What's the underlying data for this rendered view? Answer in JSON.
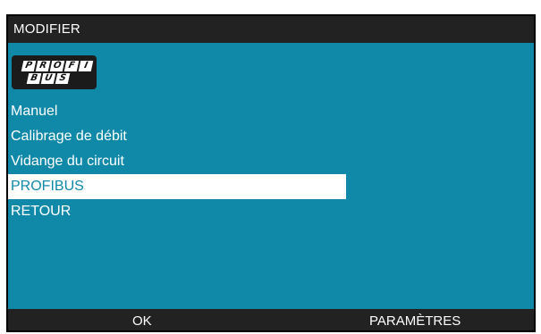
{
  "header": {
    "title": "MODIFIER"
  },
  "logo": {
    "icon": "profibus-logo-icon",
    "row1": [
      "P",
      "R",
      "O",
      "F",
      "I"
    ],
    "row2": [
      "B",
      "U",
      "S"
    ]
  },
  "menu": {
    "items": [
      {
        "label": "Manuel"
      },
      {
        "label": "Calibrage de débit"
      },
      {
        "label": "Vidange du circuit"
      },
      {
        "label": "PROFIBUS"
      },
      {
        "label": "RETOUR"
      }
    ],
    "selected_index": 3
  },
  "softkeys": {
    "left_label": "OK",
    "right_label": "PARAMÈTRES"
  },
  "colors": {
    "background": "#1089a9",
    "bars": "#222222",
    "text": "#ffffff",
    "highlight": "#ffffff"
  }
}
